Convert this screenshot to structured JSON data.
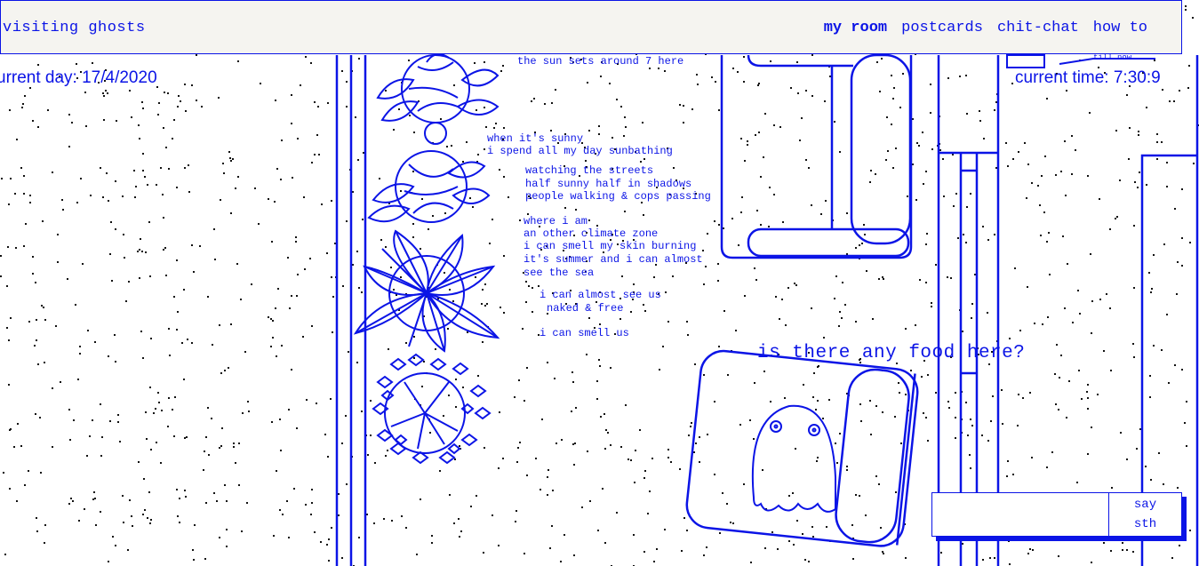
{
  "site": {
    "title": "visiting ghosts"
  },
  "nav": [
    {
      "label": "my room",
      "active": true
    },
    {
      "label": "postcards",
      "active": false
    },
    {
      "label": "chit-chat",
      "active": false
    },
    {
      "label": "how to",
      "active": false
    }
  ],
  "status": {
    "day": "urrent day: 17/4/2020",
    "time": "current time: 7:30:9"
  },
  "scene": {
    "top_note": "till now",
    "poem_lines": [
      "the sun sets around 7 here",
      "when it's sunny",
      "i spend all my day sunbathing",
      "watching the streets",
      "half sunny half in shadows",
      "people walking & cops passing",
      "where i am",
      "an other climate zone",
      "i can smell my skin burning",
      "it's summer and i can almost",
      "see the sea",
      "i can almost see us",
      "naked & free",
      "i can smell us"
    ],
    "speech": "is there any food here?"
  },
  "chat": {
    "input_value": "",
    "button_line1": "say",
    "button_line2": "sth"
  },
  "colors": {
    "ink": "#0b14e6",
    "header_bg": "#f5f4f0",
    "background": "#ffffff"
  }
}
